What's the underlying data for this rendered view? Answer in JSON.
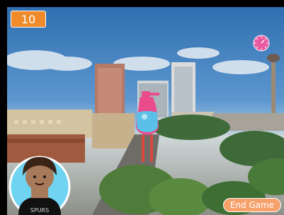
{
  "hud": {
    "score": "10",
    "end_button_label": "End Game"
  },
  "icons": {
    "timer": "clock-icon",
    "player": "player-avatar",
    "target": "bottle-character"
  },
  "colors": {
    "hud_orange": "#f08a2a",
    "end_button": "#f6a06a",
    "clock_pink": "#e85aa0",
    "bottle_pink": "#e94b8d",
    "bottle_blue": "#5bc0e8",
    "player_ring": "#6fd4f2"
  },
  "avatar": {
    "shirt_text": "SPURS"
  }
}
